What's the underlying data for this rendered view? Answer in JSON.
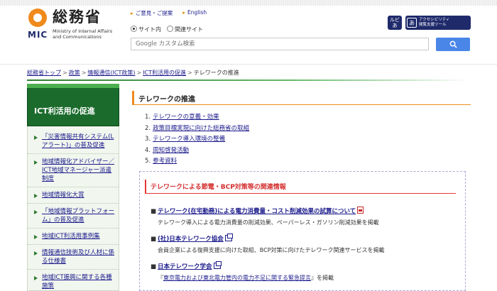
{
  "header": {
    "logo_jp": "総務省",
    "logo_abbr": "MIC",
    "logo_en_1": "Ministry of Internal Affairs",
    "logo_en_2": "and Communications",
    "links": [
      {
        "label": "ご意見・ご提案"
      },
      {
        "label": "English"
      }
    ],
    "radio_site": "サイト内",
    "radio_related": "関連サイト",
    "search_placeholder": "Google カスタム検索",
    "ruby_label": "ルビ",
    "ruby_glyph": "あ",
    "tool_glyph": "あ",
    "tool_label_1": "アクセシビリティ",
    "tool_label_2": "閲覧支援ツール"
  },
  "breadcrumb": [
    {
      "label": "総務省トップ",
      "link": true
    },
    {
      "label": "政策",
      "link": true
    },
    {
      "label": "情報通信(ICT政策)",
      "link": true
    },
    {
      "label": "ICT利活用の促進",
      "link": true
    },
    {
      "label": "テレワークの推進",
      "link": false
    }
  ],
  "sidebar": {
    "title": "ICT利活用の促進",
    "items": [
      {
        "label": "「災害情報共有システム(Lアラート)」の普及促進"
      },
      {
        "label": "地域情報化アドバイザー／ICT地域マネージャー派遣制度"
      },
      {
        "label": "地域情報化大賞"
      },
      {
        "label": "「地域情報プラットフォーム」の普及促進"
      },
      {
        "label": "地域ICT利活用事例集"
      },
      {
        "label": "情報通信技術及び人材に係る仕様書"
      },
      {
        "label": "地域ICT振興に関する各種施策"
      }
    ]
  },
  "main": {
    "title": "テレワークの推進",
    "toc": [
      {
        "num": "1.",
        "label": "テレワークの意義・効果"
      },
      {
        "num": "2.",
        "label": "政策目標実現に向けた総務省の取組"
      },
      {
        "num": "3.",
        "label": "テレワーク導入環境の整備"
      },
      {
        "num": "4.",
        "label": "周知啓発活動"
      },
      {
        "num": "5.",
        "label": "参考資料"
      }
    ],
    "box": {
      "title": "テレワークによる節電・BCP対策等の関連情報",
      "entries": [
        {
          "marker": "■",
          "title": "テレワーク(在宅勤務)による電力消費量・コスト削減効果の試算について",
          "icon": "pdf-icon",
          "desc": "テレワーク導入による電力消費量の削減効果、ペーパーレス・ガソリン削減効果を掲載"
        },
        {
          "marker": "■",
          "title": "(社)日本テレワーク協会",
          "icon": "external-link-icon",
          "desc": "会員企業による復興支援に向けた取組、BCP対策に向けたテレワーク関連サービスを掲載"
        },
        {
          "marker": "■",
          "title": "日本テレワーク学会",
          "icon": "external-link-icon",
          "desc_prefix": "『",
          "desc_link": "東京電力および東北電力管内の電力不足に関する緊急提言",
          "desc_suffix": "』を掲載"
        }
      ]
    }
  },
  "colors": {
    "brand_orange": "#f08a1c",
    "brand_navy": "#1f2a6b",
    "sidebar_green": "#1b6b2c",
    "alert_red": "#d32f2f",
    "search_blue": "#4a86e8"
  }
}
